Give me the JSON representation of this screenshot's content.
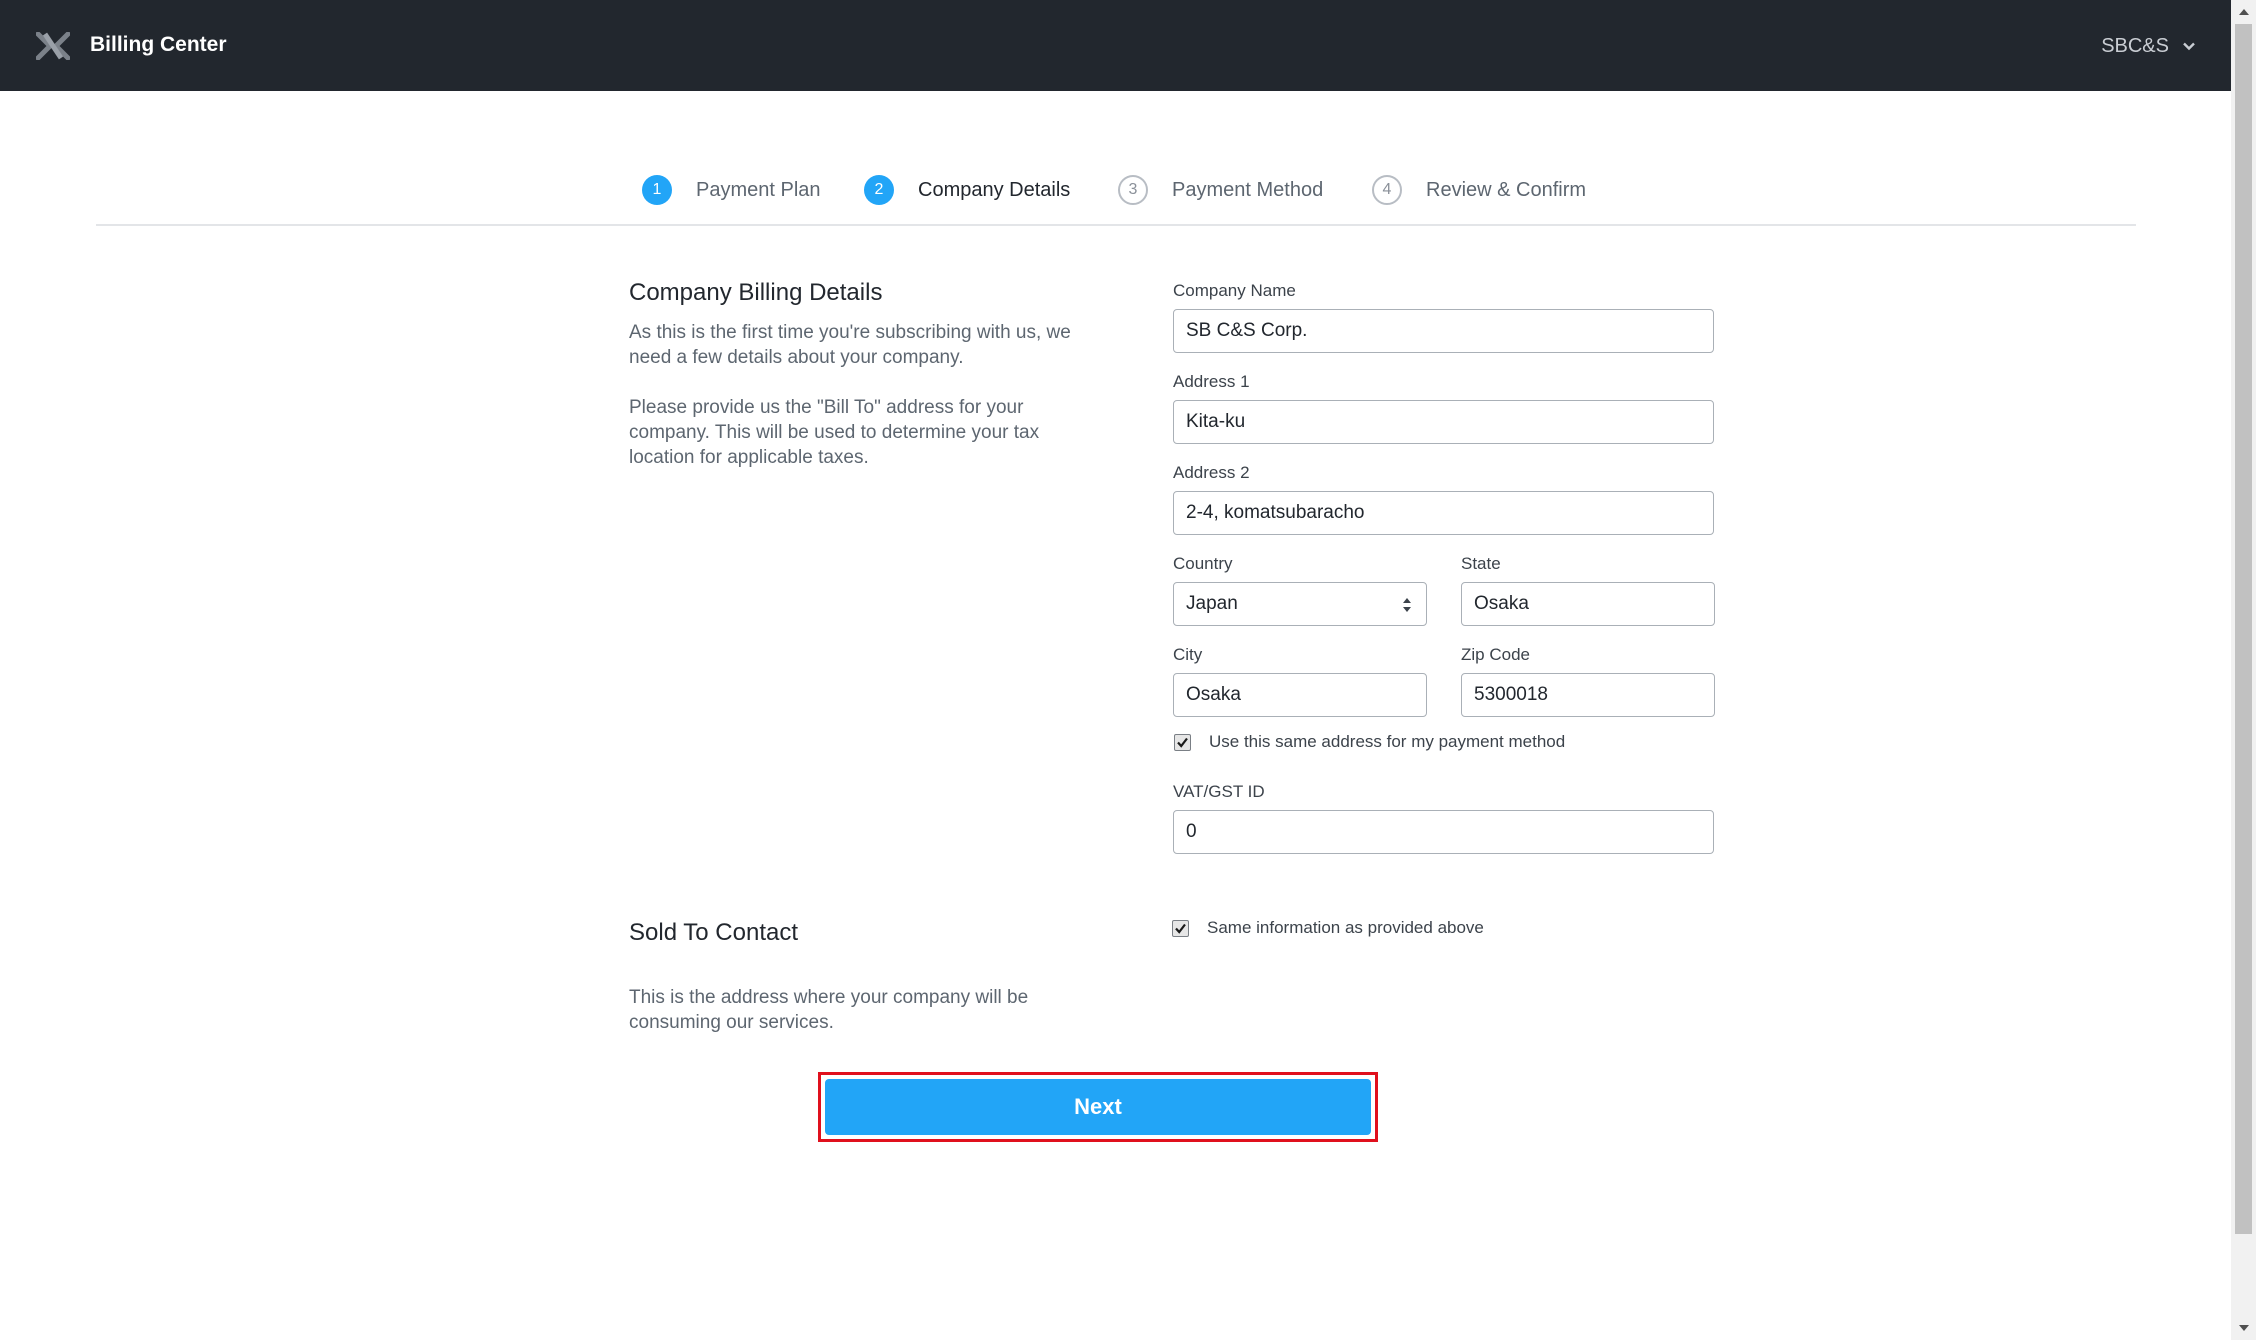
{
  "header": {
    "app_title": "Billing Center",
    "user_menu_label": "SBC&S",
    "logo_icon": "nutanix-x-logo"
  },
  "steps": [
    {
      "number": "1",
      "label": "Payment Plan",
      "state": "completed"
    },
    {
      "number": "2",
      "label": "Company Details",
      "state": "active"
    },
    {
      "number": "3",
      "label": "Payment Method",
      "state": "pending"
    },
    {
      "number": "4",
      "label": "Review & Confirm",
      "state": "pending"
    }
  ],
  "billing": {
    "title": "Company Billing Details",
    "desc1": "As this is the first time you're subscribing with us, we need a few details about your company.",
    "desc2": "Please provide us the \"Bill To\" address for your company. This will be used to determine your tax location for applicable taxes."
  },
  "form": {
    "company_name": {
      "label": "Company Name",
      "value": "SB C&S Corp."
    },
    "address1": {
      "label": "Address 1",
      "value": "Kita-ku"
    },
    "address2": {
      "label": "Address 2",
      "value": "2-4, komatsubaracho"
    },
    "country": {
      "label": "Country",
      "value": "Japan"
    },
    "state": {
      "label": "State",
      "value": "Osaka"
    },
    "city": {
      "label": "City",
      "value": "Osaka"
    },
    "zip": {
      "label": "Zip Code",
      "value": "5300018"
    },
    "same_address": {
      "label": "Use this same address for my payment method",
      "checked": true
    },
    "vat": {
      "label": "VAT/GST ID",
      "value": "0"
    }
  },
  "sold_to": {
    "title": "Sold To Contact",
    "desc": "This is the address where your company will be consuming our services.",
    "same_info": {
      "label": "Same information as provided above",
      "checked": true
    }
  },
  "actions": {
    "next_label": "Next"
  },
  "colors": {
    "accent": "#22a5f7",
    "header_bg": "#22272e",
    "highlight": "#e0101d"
  }
}
